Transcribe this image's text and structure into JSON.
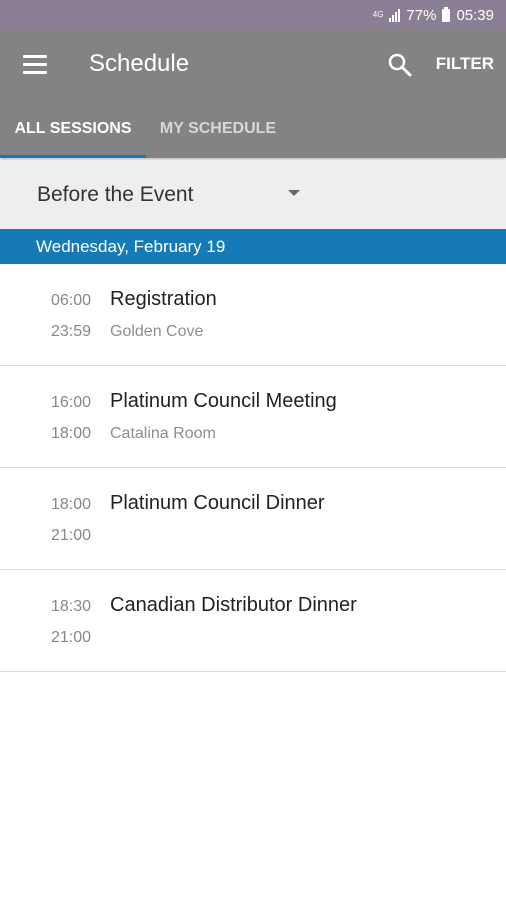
{
  "status_bar": {
    "network": "4G",
    "battery": "77%",
    "time": "05:39"
  },
  "app_bar": {
    "title": "Schedule",
    "filter_label": "FILTER",
    "icons": [
      "menu-icon",
      "search-icon"
    ]
  },
  "tabs": [
    {
      "label": "ALL SESSIONS",
      "selected": true
    },
    {
      "label": "MY SCHEDULE",
      "selected": false
    }
  ],
  "dropdown": {
    "selected": "Before the Event"
  },
  "day": {
    "label": "Wednesday, February 19"
  },
  "sessions": [
    {
      "start": "06:00",
      "end": "23:59",
      "title": "Registration",
      "location": "Golden Cove"
    },
    {
      "start": "16:00",
      "end": "18:00",
      "title": "Platinum Council Meeting",
      "location": "Catalina Room"
    },
    {
      "start": "18:00",
      "end": "21:00",
      "title": "Platinum Council Dinner",
      "location": ""
    },
    {
      "start": "18:30",
      "end": "21:00",
      "title": "Canadian Distributor Dinner",
      "location": ""
    }
  ],
  "colors": {
    "status_bar": "#8b7f96",
    "app_bar": "#838383",
    "accent": "#157ab5",
    "dropdown_bg": "#eeeeee"
  }
}
